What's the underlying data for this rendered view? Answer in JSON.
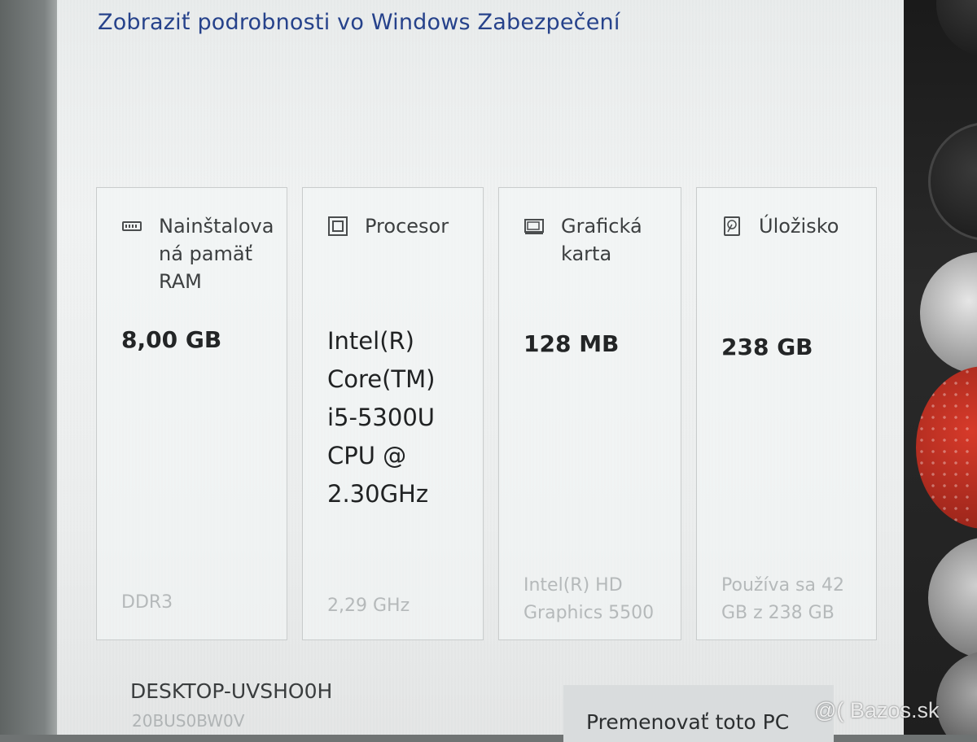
{
  "header": {
    "link_text": "Zobraziť podrobnosti vo Windows Zabezpečení"
  },
  "cards": {
    "ram": {
      "icon": "memory-icon",
      "title": "Nainštalovaná pamäť RAM",
      "title_lines": [
        "Nainštalova",
        "ná pamäť",
        "RAM"
      ],
      "value": "8,00 GB",
      "detail": "DDR3"
    },
    "cpu": {
      "icon": "processor-icon",
      "title": "Procesor",
      "value_lines": [
        "Intel(R)",
        "Core(TM)",
        "i5-5300U",
        "CPU @",
        "2.30GHz"
      ],
      "detail": "2,29 GHz"
    },
    "gpu": {
      "icon": "display-adapter-icon",
      "title_lines": [
        "Grafická",
        "karta"
      ],
      "value": "128 MB",
      "detail_lines": [
        "Intel(R) HD",
        "Graphics 5500"
      ]
    },
    "storage": {
      "icon": "storage-icon",
      "title": "Úložisko",
      "value": "238 GB",
      "detail_lines": [
        "Používa sa 42",
        "GB z 238 GB"
      ]
    }
  },
  "device": {
    "name": "DESKTOP-UVSHO0H",
    "model": "20BUS0BW0V",
    "rename_button_label": "Premenovať toto PC"
  },
  "watermark": "@( Bazos.sk",
  "colors": {
    "link": "#26428b",
    "background": "#eceeee",
    "button": "#d9dcdd"
  }
}
